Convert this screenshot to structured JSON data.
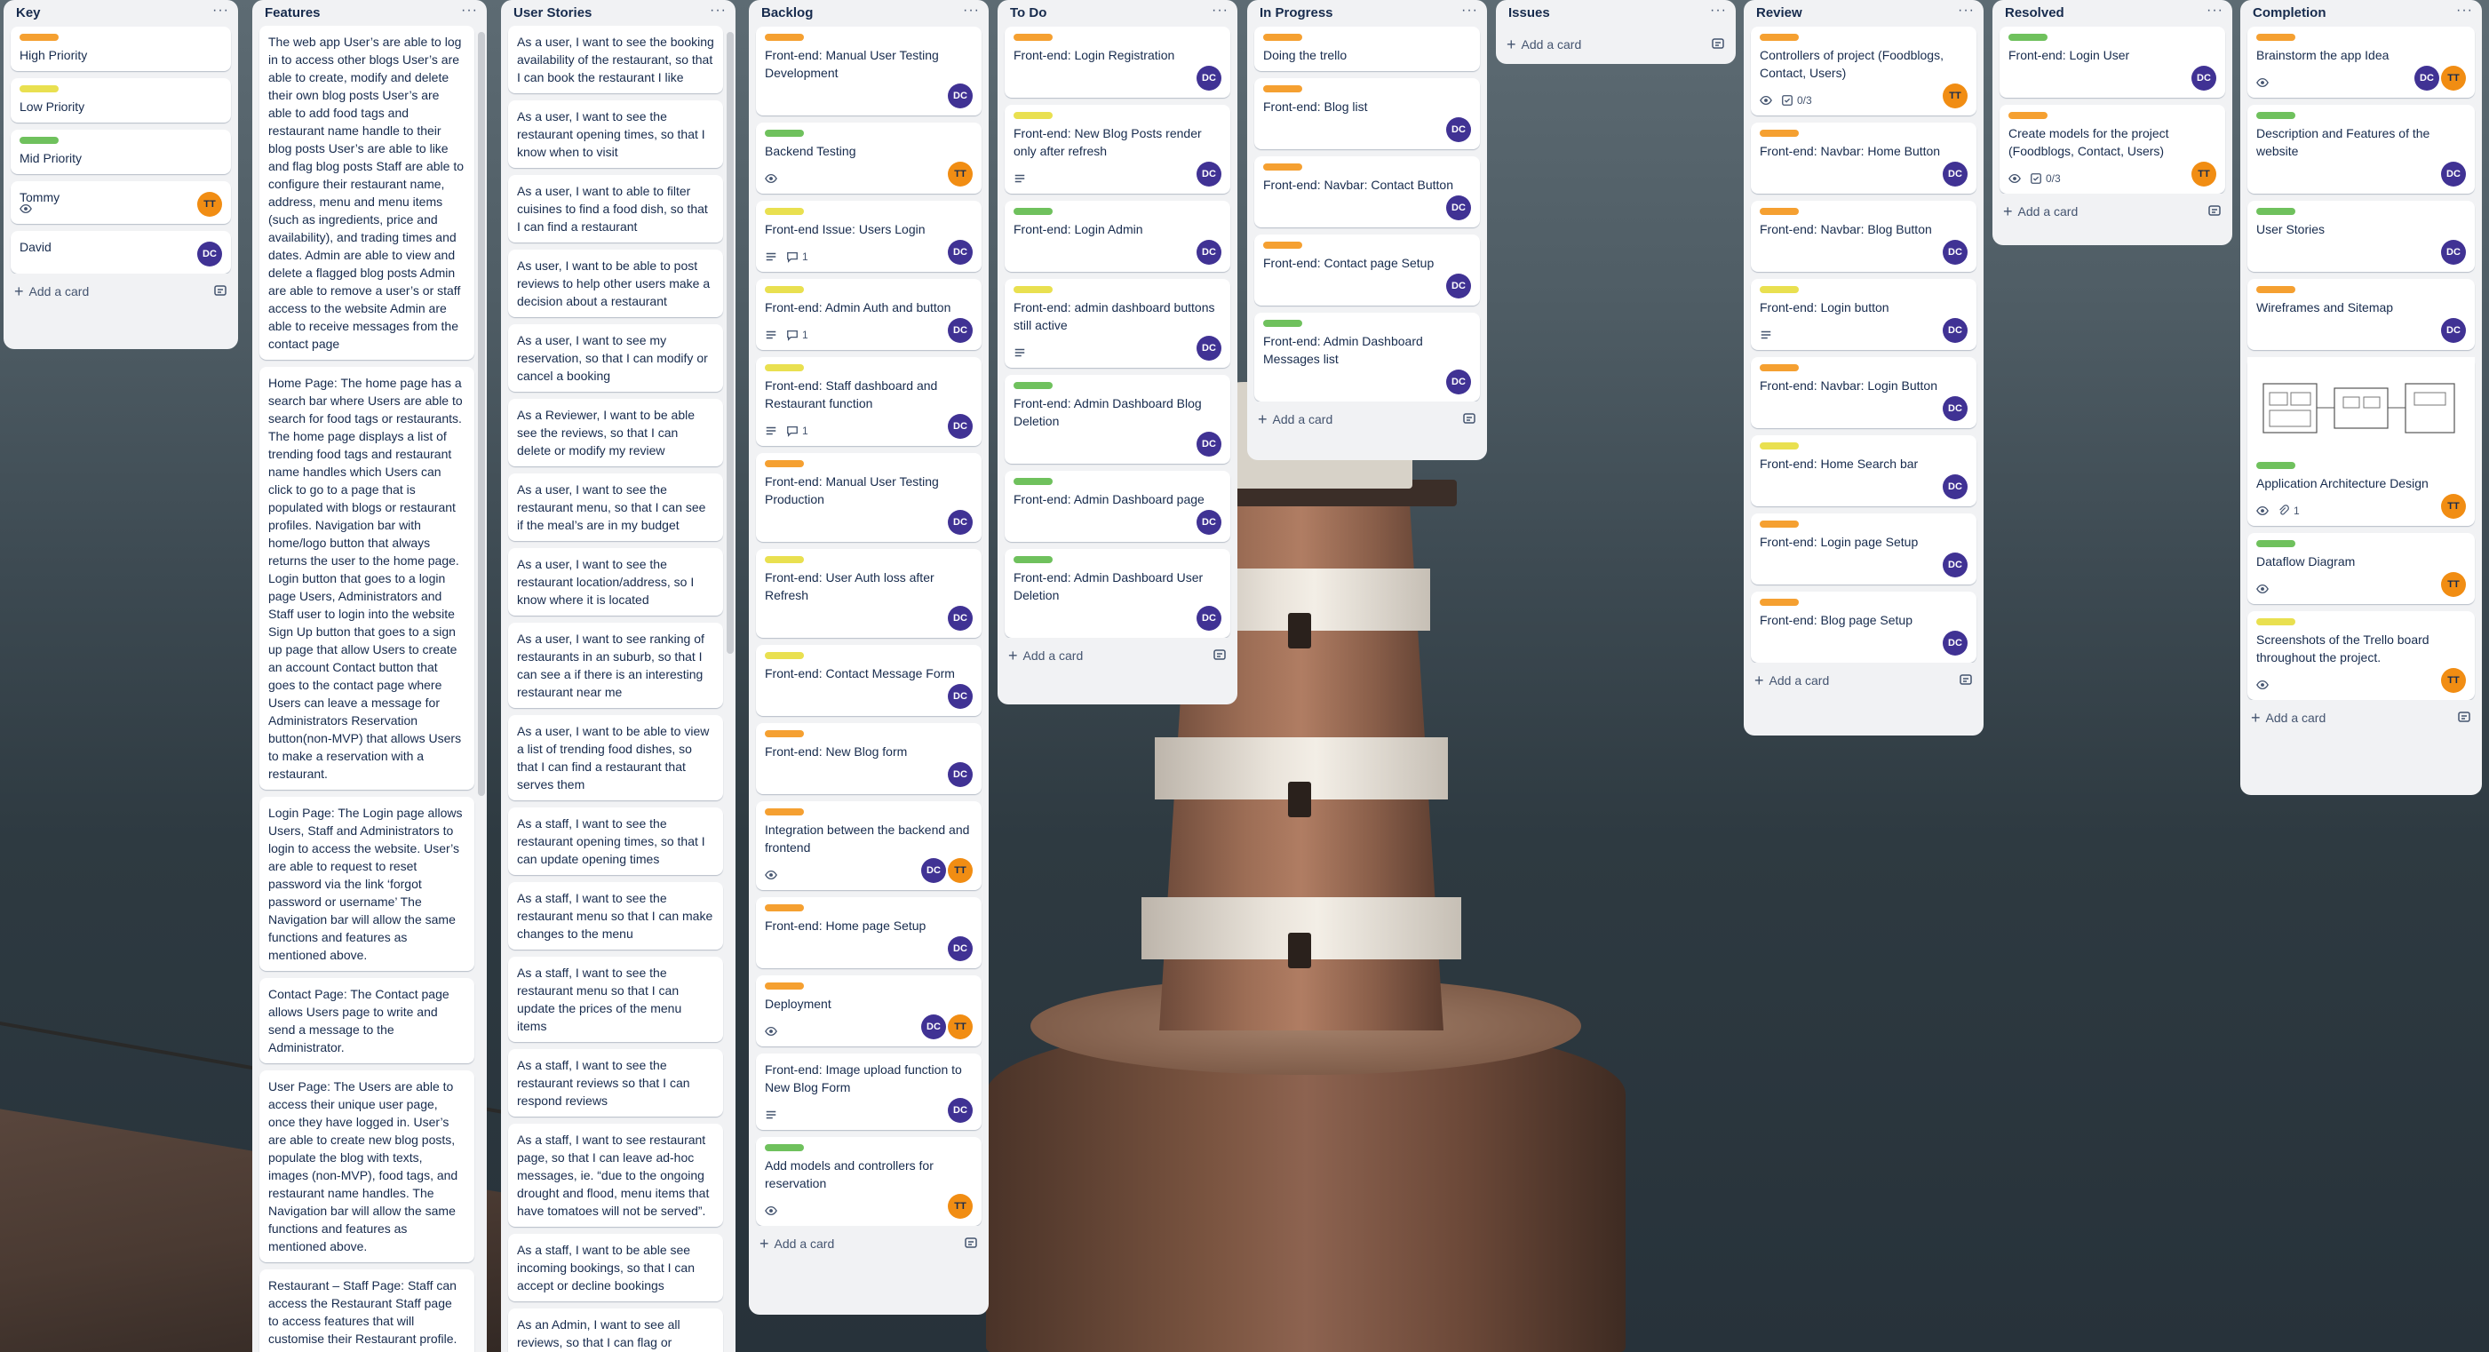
{
  "colors": {
    "orange": "#f5a031",
    "yellow": "#e9e050",
    "green": "#6fc15d",
    "dc": "#403294",
    "tt": "#f18d13"
  },
  "lists": {
    "key": {
      "title": "Key",
      "cards": [
        {
          "label_color": "orange",
          "title": "High Priority"
        },
        {
          "label_color": "yellow",
          "title": "Low Priority"
        },
        {
          "label_color": "green",
          "title": "Mid Priority"
        },
        {
          "title": "Tommy",
          "avatar": "TT",
          "icon": "eye-icon"
        },
        {
          "title": "David",
          "avatar": "DC"
        }
      ],
      "add_label": "Add a card"
    },
    "features": {
      "title": "Features",
      "cards": [
        "The web app User’s are able to log in to access other blogs User’s are able to create, modify and delete their own blog posts User’s are able to add food tags and restaurant name handle to their blog posts User’s are able to like and flag blog posts Staff are able to configure their restaurant name, address, menu and menu items (such as ingredients, price and availability), and trading times and dates. Admin are able to view and delete a flagged blog posts Admin are able to remove a user’s or staff access to the website Admin are able to receive messages from the contact page",
        "Home Page: The home page has a search bar where Users are able to search for food tags or restaurants. The home page displays a list of trending food tags and restaurant name handles which Users can click to go to a page that is populated with blogs or restaurant profiles. Navigation bar with home/logo button that always returns the user to the home page. Login button that goes to a login page Users, Administrators and Staff user to login into the website Sign Up button that goes to a sign up page that allow Users to create an account Contact button that goes to the contact page where Users can leave a message for Administrators Reservation button(non-MVP) that allows Users to make a reservation with a restaurant.",
        "Login Page: The Login page allows Users, Staff and Administrators to login to access the website. User’s are able to request to reset password via the link ‘forgot password or username’ The Navigation bar will allow the same functions and features as mentioned above.",
        "Contact Page: The Contact page allows Users page to write and send a message to the Administrator.",
        "User Page: The Users are able to access their unique user page, once they have logged in. User’s are able to create new blog posts, populate the blog with texts, images (non-MVP), food tags, and restaurant name handles. The Navigation bar will allow the same functions and features as mentioned above.",
        "Restaurant – Staff Page: Staff can access the Restaurant Staff page to access features that will customise their Restaurant profile. Staff are able to add Menu Item to their"
      ]
    },
    "stories": {
      "title": "User Stories",
      "cards": [
        "As a user, I want to see the booking availability of the restaurant, so that I can book the restaurant I like",
        "As a user, I want to see the restaurant opening times, so that I know when to visit",
        "As a user, I want to able to filter cuisines to find a food dish, so that I can find a restaurant",
        "As user, I want to be able to post reviews to help other users make a decision about a restaurant",
        "As a user, I want to see my reservation, so that I can modify or cancel a booking",
        "As a Reviewer, I want to be able see the reviews, so that I can delete or modify my review",
        "As a user, I want to see the restaurant menu, so that I can see if the meal’s are in my budget",
        "As a user, I want to see the restaurant location/address, so I know where it is located",
        "As a user, I want to see ranking of restaurants in an suburb, so that I can see a if there is an interesting restaurant near me",
        "As a user, I want to be able to view a list of trending food dishes, so that I can find a restaurant that serves them",
        "As a staff, I want to see the restaurant opening times, so that I can update opening times",
        "As a staff, I want to see the restaurant menu so that I can make changes to the menu",
        "As a staff, I want to see the restaurant menu so that I can update the prices of the menu items",
        "As a staff, I want to see the restaurant reviews so that I can respond reviews",
        "As a staff, I want to see restaurant page, so that I can leave ad-hoc messages, ie. “due to the ongoing drought and flood, menu items that have tomatoes will not be served”.",
        "As a staff, I want to be able see incoming bookings, so that I can accept or decline bookings",
        "As an Admin, I want to see all reviews, so that I can flag or remove reviews and conversations that are not constructive"
      ]
    },
    "backlog": {
      "title": "Backlog",
      "cards": [
        {
          "label_color": "orange",
          "title": "Front-end: Manual User Testing Development",
          "members": [
            "DC"
          ]
        },
        {
          "label_color": "green",
          "title": "Backend Testing",
          "watch": true,
          "members": [
            "TT"
          ]
        },
        {
          "label_color": "yellow",
          "title": "Front-end Issue: Users Login",
          "desc": true,
          "comments": "1",
          "members": [
            "DC"
          ]
        },
        {
          "label_color": "yellow",
          "title": "Front-end: Admin Auth and button",
          "desc": true,
          "comments": "1",
          "members": [
            "DC"
          ]
        },
        {
          "label_color": "yellow",
          "title": "Front-end: Staff dashboard and Restaurant function",
          "desc": true,
          "comments": "1",
          "members": [
            "DC"
          ]
        },
        {
          "label_color": "orange",
          "title": "Front-end: Manual User Testing Production",
          "members": [
            "DC"
          ]
        },
        {
          "label_color": "yellow",
          "title": "Front-end: User Auth loss after Refresh",
          "members": [
            "DC"
          ]
        },
        {
          "label_color": "yellow",
          "title": "Front-end: Contact Message Form",
          "members": [
            "DC"
          ]
        },
        {
          "label_color": "orange",
          "title": "Front-end: New Blog form",
          "members": [
            "DC"
          ]
        },
        {
          "label_color": "orange",
          "title": "Integration between the backend and frontend",
          "watch": true,
          "members": [
            "DC",
            "TT"
          ]
        },
        {
          "label_color": "orange",
          "title": "Front-end: Home page Setup",
          "members": [
            "DC"
          ]
        },
        {
          "label_color": "orange",
          "title": "Deployment",
          "watch": true,
          "members": [
            "DC",
            "TT"
          ]
        },
        {
          "title": "Front-end: Image upload function to New Blog Form",
          "desc": true,
          "members": [
            "DC"
          ]
        },
        {
          "label_color": "green",
          "title": "Add models and controllers for reservation",
          "watch": true,
          "members": [
            "TT"
          ]
        }
      ],
      "add_label": "Add a card"
    },
    "todo": {
      "title": "To Do",
      "cards": [
        {
          "label_color": "orange",
          "title": "Front-end: Login Registration",
          "members": [
            "DC"
          ]
        },
        {
          "label_color": "yellow",
          "title": "Front-end: New Blog Posts render only after refresh",
          "desc": true,
          "members": [
            "DC"
          ]
        },
        {
          "label_color": "green",
          "title": "Front-end: Login Admin",
          "members": [
            "DC"
          ]
        },
        {
          "label_color": "yellow",
          "title": "Front-end: admin dashboard buttons still active",
          "desc": true,
          "members": [
            "DC"
          ]
        },
        {
          "label_color": "green",
          "title": "Front-end: Admin Dashboard Blog Deletion",
          "members": [
            "DC"
          ]
        },
        {
          "label_color": "green",
          "title": "Front-end: Admin Dashboard page",
          "members": [
            "DC"
          ]
        },
        {
          "label_color": "green",
          "title": "Front-end: Admin Dashboard User Deletion",
          "members": [
            "DC"
          ]
        }
      ],
      "add_label": "Add a card"
    },
    "inprogress": {
      "title": "In Progress",
      "cards": [
        {
          "label_color": "orange",
          "title": "Doing the trello"
        },
        {
          "label_color": "orange",
          "title": "Front-end: Blog list",
          "members": [
            "DC"
          ]
        },
        {
          "label_color": "orange",
          "title": "Front-end: Navbar: Contact Button",
          "members": [
            "DC"
          ]
        },
        {
          "label_color": "orange",
          "title": "Front-end: Contact page Setup",
          "members": [
            "DC"
          ]
        },
        {
          "label_color": "green",
          "title": "Front-end: Admin Dashboard Messages list",
          "members": [
            "DC"
          ]
        }
      ],
      "add_label": "Add a card"
    },
    "issues": {
      "title": "Issues",
      "add_label": "Add a card"
    },
    "review": {
      "title": "Review",
      "cards": [
        {
          "label_color": "orange",
          "title": "Controllers of project (Foodblogs, Contact, Users)",
          "watch": true,
          "checklist": "0/3",
          "members": [
            "TT"
          ]
        },
        {
          "label_color": "orange",
          "title": "Front-end: Navbar: Home Button",
          "members": [
            "DC"
          ]
        },
        {
          "label_color": "orange",
          "title": "Front-end: Navbar: Blog Button",
          "members": [
            "DC"
          ]
        },
        {
          "label_color": "yellow",
          "title": "Front-end: Login button",
          "desc": true,
          "members": [
            "DC"
          ]
        },
        {
          "label_color": "orange",
          "title": "Front-end: Navbar: Login Button",
          "members": [
            "DC"
          ]
        },
        {
          "label_color": "yellow",
          "title": "Front-end: Home Search bar",
          "members": [
            "DC"
          ]
        },
        {
          "label_color": "orange",
          "title": "Front-end: Login page Setup",
          "members": [
            "DC"
          ]
        },
        {
          "label_color": "orange",
          "title": "Front-end: Blog page Setup",
          "members": [
            "DC"
          ]
        }
      ],
      "add_label": "Add a card"
    },
    "resolved": {
      "title": "Resolved",
      "cards": [
        {
          "label_color": "green",
          "title": "Front-end: Login User",
          "members": [
            "DC"
          ]
        },
        {
          "label_color": "orange",
          "title": "Create models for the project (Foodblogs, Contact, Users)",
          "watch": true,
          "checklist": "0/3",
          "members": [
            "TT"
          ]
        }
      ],
      "add_label": "Add a card"
    },
    "completion": {
      "title": "Completion",
      "cards": [
        {
          "label_color": "orange",
          "title": "Brainstorm the app Idea",
          "watch": true,
          "members": [
            "DC",
            "TT"
          ]
        },
        {
          "label_color": "green",
          "title": "Description and Features of the website",
          "members": [
            "DC"
          ]
        },
        {
          "label_color": "green",
          "title": "User Stories",
          "members": [
            "DC"
          ]
        },
        {
          "label_color": "orange",
          "title": "Wireframes and Sitemap",
          "members": [
            "DC"
          ]
        },
        {
          "cover": true,
          "label_color": "green",
          "title": "Application Architecture Design",
          "watch": true,
          "attachments": "1",
          "members": [
            "TT"
          ]
        },
        {
          "label_color": "green",
          "title": "Dataflow Diagram",
          "watch": true,
          "members": [
            "TT"
          ]
        },
        {
          "label_color": "yellow",
          "title": "Screenshots of the Trello board throughout the project.",
          "watch": true,
          "members": [
            "TT"
          ]
        }
      ],
      "add_label": "Add a card"
    }
  }
}
